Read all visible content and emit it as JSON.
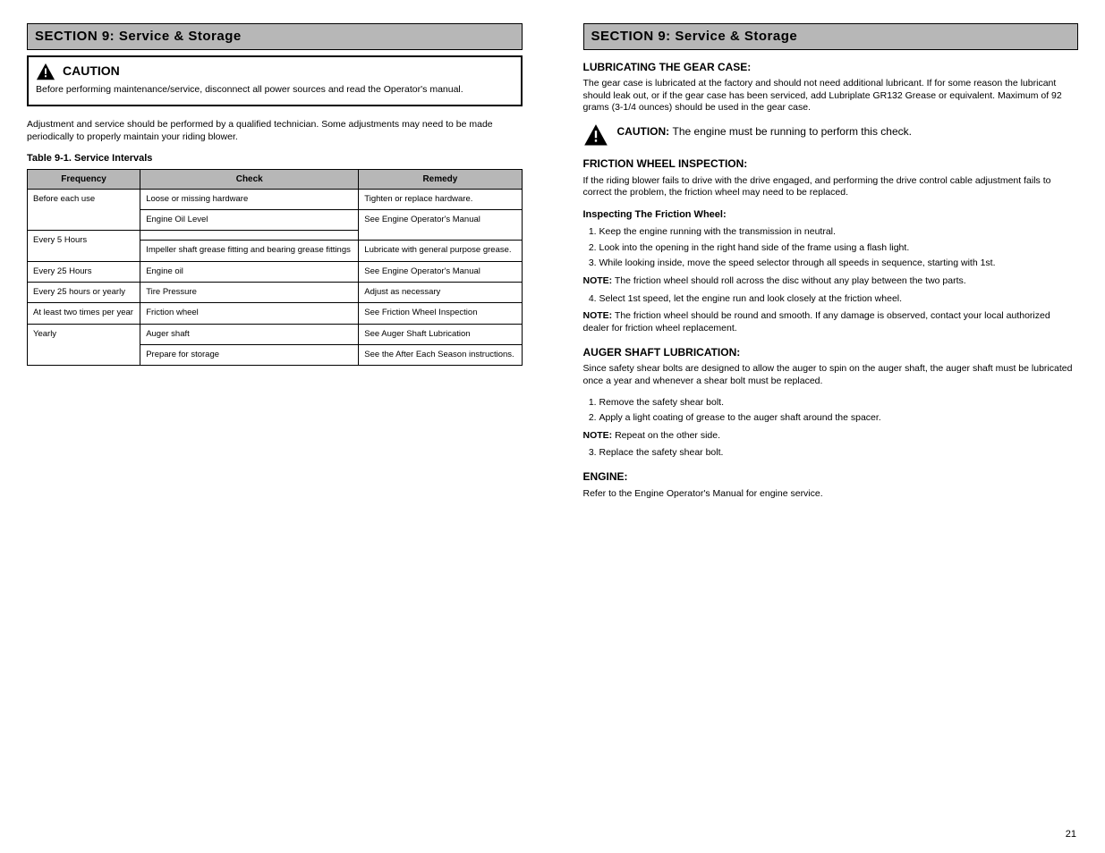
{
  "left": {
    "sec_heading": "SECTION 9: Service & Storage",
    "caution_word": "CAUTION",
    "caution_text": "Before performing maintenance/service, disconnect all power sources and read the Operator's manual.",
    "intro": "Adjustment and service should be performed by a qualified technician. Some adjustments may need to be made periodically to properly maintain your riding blower.",
    "table_title": "Table 9-1. Service Intervals",
    "headers": [
      "Frequency",
      "Check",
      "Remedy"
    ],
    "rows": [
      {
        "f": "Before each use",
        "c": "Loose or missing hardware",
        "r": "Tighten or replace hardware."
      },
      {
        "f": "Before each use",
        "c": "Engine Oil Level",
        "r": ""
      },
      {
        "f": "",
        "c": "",
        "r": "See Engine Operator's Manual"
      },
      {
        "f": "Every 5 Hours",
        "c": "Impeller shaft grease fitting and bearing grease fittings",
        "r": "Lubricate with general purpose grease."
      },
      {
        "f": "Every 25 Hours",
        "c": "Engine oil",
        "r": "See Engine Operator's Manual"
      },
      {
        "f": "Every 25 hours or yearly",
        "c": "Tire Pressure",
        "r": "Adjust as necessary"
      },
      {
        "f": "At least two times per year",
        "c": "Friction wheel",
        "r": "See Friction Wheel Inspection"
      },
      {
        "f": "Yearly",
        "c": "Auger shaft",
        "r": "See Auger Shaft Lubrication"
      },
      {
        "f": "Yearly",
        "c": "Prepare for storage",
        "r": "See the After Each Season instructions."
      }
    ]
  },
  "right": {
    "sec_heading": "SECTION 9: Service & Storage",
    "h_gearcase": "LUBRICATING THE GEAR CASE:",
    "gearcase_p": "The gear case is lubricated at the factory and should not need additional lubricant. If for some reason the lubricant should leak out, or if the gear case has been serviced, add Lubriplate GR132 Grease or equivalent. Maximum of 92 grams (3-1/4 ounces) should be used in the gear case.",
    "warn_word": "CAUTION",
    "warn_text": "The engine must be running to perform this check.",
    "h_friction": "FRICTION WHEEL INSPECTION:",
    "friction_p": "If the riding blower fails to drive with the drive engaged, and performing the drive control cable adjustment fails to correct the problem, the friction wheel may need to be replaced.",
    "h_inspect": "Inspecting The Friction Wheel:",
    "steps": [
      "Keep the engine running with the transmission in neutral.",
      "Look into the opening in the right hand side of the frame using a flash light.",
      "While looking inside, move the speed selector through all speeds in sequence, starting with 1st."
    ],
    "note_word": "NOTE:",
    "note1": "The friction wheel should roll across the disc without any play between the two parts.",
    "step4": "Select 1st speed, let the engine run and look closely at the friction wheel.",
    "note2": "The friction wheel should be round and smooth. If any damage is observed, contact your local authorized dealer for friction wheel replacement.",
    "h_auger": "AUGER SHAFT LUBRICATION:",
    "auger_p1": "Since safety shear bolts are designed to allow the auger to spin on the auger shaft, the auger shaft must be lubricated once a year and whenever a shear bolt must be replaced.",
    "auger_steps": [
      "Remove the safety shear bolt.",
      "Apply a light coating of grease to the auger shaft around the spacer."
    ],
    "note3": "Repeat on the other side.",
    "auger_step3": "Replace the safety shear bolt.",
    "h_eng": "ENGINE:",
    "eng_p": "Refer to the Engine Operator's Manual for engine service."
  },
  "page": "21"
}
